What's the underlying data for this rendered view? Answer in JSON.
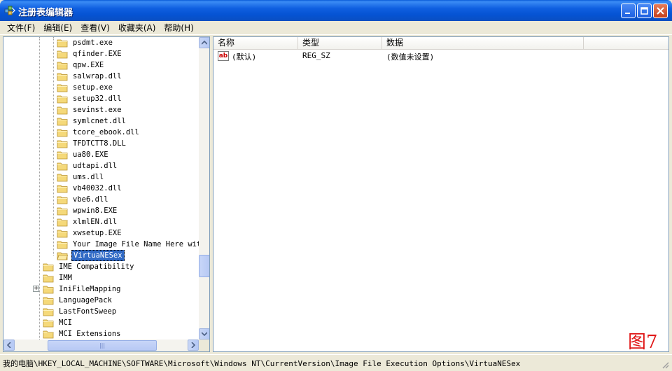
{
  "window": {
    "title": "注册表编辑器"
  },
  "menu": [
    {
      "label": "文件(F)"
    },
    {
      "label": "编辑(E)"
    },
    {
      "label": "查看(V)"
    },
    {
      "label": "收藏夹(A)"
    },
    {
      "label": "帮助(H)"
    }
  ],
  "tree": {
    "items": [
      {
        "label": "psdmt.exe"
      },
      {
        "label": "qfinder.EXE"
      },
      {
        "label": "qpw.EXE"
      },
      {
        "label": "salwrap.dll"
      },
      {
        "label": "setup.exe"
      },
      {
        "label": "setup32.dll"
      },
      {
        "label": "sevinst.exe"
      },
      {
        "label": "symlcnet.dll"
      },
      {
        "label": "tcore_ebook.dll"
      },
      {
        "label": "TFDTCTT8.DLL"
      },
      {
        "label": "ua80.EXE"
      },
      {
        "label": "udtapi.dll"
      },
      {
        "label": "ums.dll"
      },
      {
        "label": "vb40032.dll"
      },
      {
        "label": "vbe6.dll"
      },
      {
        "label": "wpwin8.EXE"
      },
      {
        "label": "xlmlEN.dll"
      },
      {
        "label": "xwsetup.EXE"
      },
      {
        "label": "Your Image File Name Here without"
      },
      {
        "label": "VirtuaNESex",
        "selected": true
      }
    ],
    "parent_items": [
      {
        "label": "IME Compatibility"
      },
      {
        "label": "IMM"
      },
      {
        "label": "IniFileMapping",
        "expandable": true
      },
      {
        "label": "LanguagePack"
      },
      {
        "label": "LastFontSweep"
      },
      {
        "label": "MCI"
      },
      {
        "label": "MCI Extensions"
      }
    ],
    "hscroll_grip": "|||"
  },
  "list": {
    "columns": [
      {
        "label": "名称"
      },
      {
        "label": "类型"
      },
      {
        "label": "数据"
      }
    ],
    "rows": [
      {
        "icon": "string-value-icon",
        "icon_text": "ab",
        "name": "(默认)",
        "type": "REG_SZ",
        "data": "(数值未设置)"
      }
    ]
  },
  "watermark": "图7",
  "status": {
    "path": "我的电脑\\HKEY_LOCAL_MACHINE\\SOFTWARE\\Microsoft\\Windows NT\\CurrentVersion\\Image File Execution Options\\VirtuaNESex"
  },
  "colors": {
    "titlebar": "#0553d3",
    "selection": "#316ac5",
    "folder": "#f5d97a",
    "watermark": "#e01818"
  }
}
